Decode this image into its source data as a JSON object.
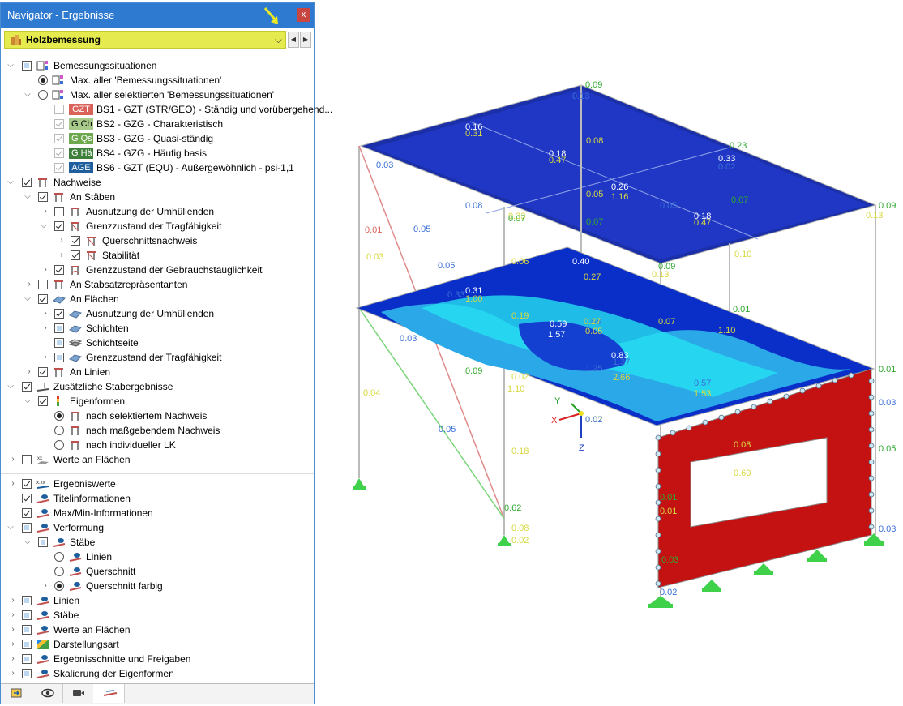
{
  "window": {
    "title": "Navigator - Ergebnisse",
    "close": "x"
  },
  "dropdown": {
    "selected": "Holzbemessung",
    "chevron": "⌵",
    "prev": "◀",
    "next": "▶"
  },
  "tree": {
    "bemessungssituationen": "Bemessungssituationen",
    "max_all": "Max. aller 'Bemessungssituationen'",
    "max_selected": "Max. aller selektierten 'Bemessungssituationen'",
    "situations": [
      {
        "badge": "GZT",
        "badge_color": "#d9625a",
        "label": "BS1 - GZT (STR/GEO) - Ständig und vorübergehend..."
      },
      {
        "badge": "G Ch",
        "badge_color": "#a7c98a",
        "label": "BS2 - GZG - Charakteristisch"
      },
      {
        "badge": "G Qs",
        "badge_color": "#6ea84f",
        "label": "BS3 - GZG - Quasi-ständig"
      },
      {
        "badge": "G Hä",
        "badge_color": "#3d7f3b",
        "label": "BS4 - GZG - Häufig basis"
      },
      {
        "badge": "AGE",
        "badge_color": "#1f5f9e",
        "label": "BS6 - GZT (EQU) - Außergewöhnlich - psi-1,1"
      }
    ],
    "nachweise": "Nachweise",
    "an_staeben": "An Stäben",
    "ausnutzung_umh": "Ausnutzung der Umhüllenden",
    "grenz_trag": "Grenzzustand der Tragfähigkeit",
    "querschnitt": "Querschnittsnachweis",
    "stabilitaet": "Stabilität",
    "grenz_gebr": "Grenzzustand der Gebrauchstauglichkeit",
    "an_stabsatz": "An Stabsatzrepräsentanten",
    "an_flaechen": "An Flächen",
    "ausnutzung_umh2": "Ausnutzung der Umhüllenden",
    "schichten": "Schichten",
    "schichtseite": "Schichtseite",
    "grenz_trag2": "Grenzzustand der Tragfähigkeit",
    "an_linien": "An Linien",
    "zus_stab": "Zusätzliche Stabergebnisse",
    "eigenformen": "Eigenformen",
    "nach_sel": "nach selektiertem Nachweis",
    "nach_mass": "nach maßgebendem Nachweis",
    "nach_ind": "nach individueller LK",
    "werte_flaechen": "Werte an Flächen",
    "ergebniswerte": "Ergebniswerte",
    "titelinfo": "Titelinformationen",
    "maxmin": "Max/Min-Informationen",
    "verformung": "Verformung",
    "staebe": "Stäbe",
    "linien_sub": "Linien",
    "querschnitt_sub": "Querschnitt",
    "querschnitt_farbig": "Querschnitt farbig",
    "linien": "Linien",
    "staebe2": "Stäbe",
    "werte_flaechen2": "Werte an Flächen",
    "darstellungsart": "Darstellungsart",
    "ergebnisschnitte": "Ergebnisschnitte und Freigaben",
    "skalierung": "Skalierung der Eigenformen"
  },
  "tabs": [
    "data-icon",
    "eye-icon",
    "camera-icon",
    "results-icon"
  ],
  "model": {
    "axes": {
      "x": "X",
      "y": "Y",
      "z": "Z"
    },
    "labels": [
      {
        "t": "0.09",
        "c": "#2fa82f"
      },
      {
        "t": "0.13",
        "c": "#3b6fd8"
      },
      {
        "t": "0.16",
        "c": "#ffffff"
      },
      {
        "t": "0.31",
        "c": "#d8d840"
      },
      {
        "t": "0.08",
        "c": "#d8d840"
      },
      {
        "t": "0.18",
        "c": "#ffffff"
      },
      {
        "t": "0.47",
        "c": "#d8d840"
      },
      {
        "t": "0.23",
        "c": "#2fa82f"
      },
      {
        "t": "0.33",
        "c": "#ffffff"
      },
      {
        "t": "0.02",
        "c": "#3b6fd8"
      },
      {
        "t": "0.03",
        "c": "#3b6fd8"
      },
      {
        "t": "0.26",
        "c": "#ffffff"
      },
      {
        "t": "1.16",
        "c": "#d8d840"
      },
      {
        "t": "0.05",
        "c": "#d8d840"
      },
      {
        "t": "0.07",
        "c": "#2fa82f"
      },
      {
        "t": "0.05",
        "c": "#3b6fd8"
      },
      {
        "t": "0.18",
        "c": "#ffffff"
      },
      {
        "t": "0.47",
        "c": "#d8d840"
      },
      {
        "t": "0.07",
        "c": "#2fa82f"
      },
      {
        "t": "0.09",
        "c": "#2fa82f"
      },
      {
        "t": "0.13",
        "c": "#d8d840"
      },
      {
        "t": "0.08",
        "c": "#3b6fd8"
      },
      {
        "t": "0.33",
        "c": "#d8d840"
      },
      {
        "t": "0.07",
        "c": "#2fa82f"
      },
      {
        "t": "0.01",
        "c": "#d9625a"
      },
      {
        "t": "0.05",
        "c": "#3b6fd8"
      },
      {
        "t": "0.05",
        "c": "#3b6fd8"
      },
      {
        "t": "0.03",
        "c": "#d8d840"
      },
      {
        "t": "0.06",
        "c": "#d8d840"
      },
      {
        "t": "0.40",
        "c": "#ffffff"
      },
      {
        "t": "0.09",
        "c": "#2fa82f"
      },
      {
        "t": "0.13",
        "c": "#d8d840"
      },
      {
        "t": "0.10",
        "c": "#d8d840"
      },
      {
        "t": "0.31",
        "c": "#ffffff"
      },
      {
        "t": "1.00",
        "c": "#d8d840"
      },
      {
        "t": "0.33",
        "c": "#3b6fd8"
      },
      {
        "t": "0.27",
        "c": "#d8d840"
      },
      {
        "t": "0.19",
        "c": "#d8d840"
      },
      {
        "t": "0.59",
        "c": "#ffffff"
      },
      {
        "t": "1.57",
        "c": "#ffffff"
      },
      {
        "t": "0.05",
        "c": "#d8d840"
      },
      {
        "t": "0.07",
        "c": "#d8d840"
      },
      {
        "t": "1.10",
        "c": "#d8d840"
      },
      {
        "t": "0.83",
        "c": "#ffffff"
      },
      {
        "t": "1.37",
        "c": "#3b6fd8"
      },
      {
        "t": "1.25",
        "c": "#3b6fd8"
      },
      {
        "t": "2.66",
        "c": "#d8d840"
      },
      {
        "t": "0.57",
        "c": "#3b6fd8"
      },
      {
        "t": "1.53",
        "c": "#d8d840"
      },
      {
        "t": "0.03",
        "c": "#3b6fd8"
      },
      {
        "t": "0.09",
        "c": "#2fa82f"
      },
      {
        "t": "0.02",
        "c": "#d8d840"
      },
      {
        "t": "1.10",
        "c": "#d8d840"
      },
      {
        "t": "0.04",
        "c": "#d8d840"
      },
      {
        "t": "0.05",
        "c": "#3b6fd8"
      },
      {
        "t": "0.08",
        "c": "#d8d840"
      },
      {
        "t": "0.18",
        "c": "#d8d840"
      },
      {
        "t": "0.07",
        "c": "#d8d840"
      },
      {
        "t": "0.02",
        "c": "#3b6fd8"
      },
      {
        "t": "0.08",
        "c": "#d8d840"
      },
      {
        "t": "0.60",
        "c": "#d8d840"
      },
      {
        "t": "0.62",
        "c": "#2fa82f"
      },
      {
        "t": "0.02",
        "c": "#d8d840"
      },
      {
        "t": "0.01",
        "c": "#2fa82f"
      },
      {
        "t": "0.01",
        "c": "#d8d840"
      },
      {
        "t": "0.03",
        "c": "#2fa82f"
      },
      {
        "t": "0.02",
        "c": "#3b6fd8"
      },
      {
        "t": "0.01",
        "c": "#2fa82f"
      },
      {
        "t": "0.05",
        "c": "#2fa82f"
      },
      {
        "t": "0.03",
        "c": "#3b6fd8"
      },
      {
        "t": "0.03",
        "c": "#3b6fd8"
      },
      {
        "t": "0.01",
        "c": "#2fa82f"
      },
      {
        "t": "0.08",
        "c": "#3b6fd8"
      },
      {
        "t": "0.27",
        "c": "#d8d840"
      }
    ]
  }
}
